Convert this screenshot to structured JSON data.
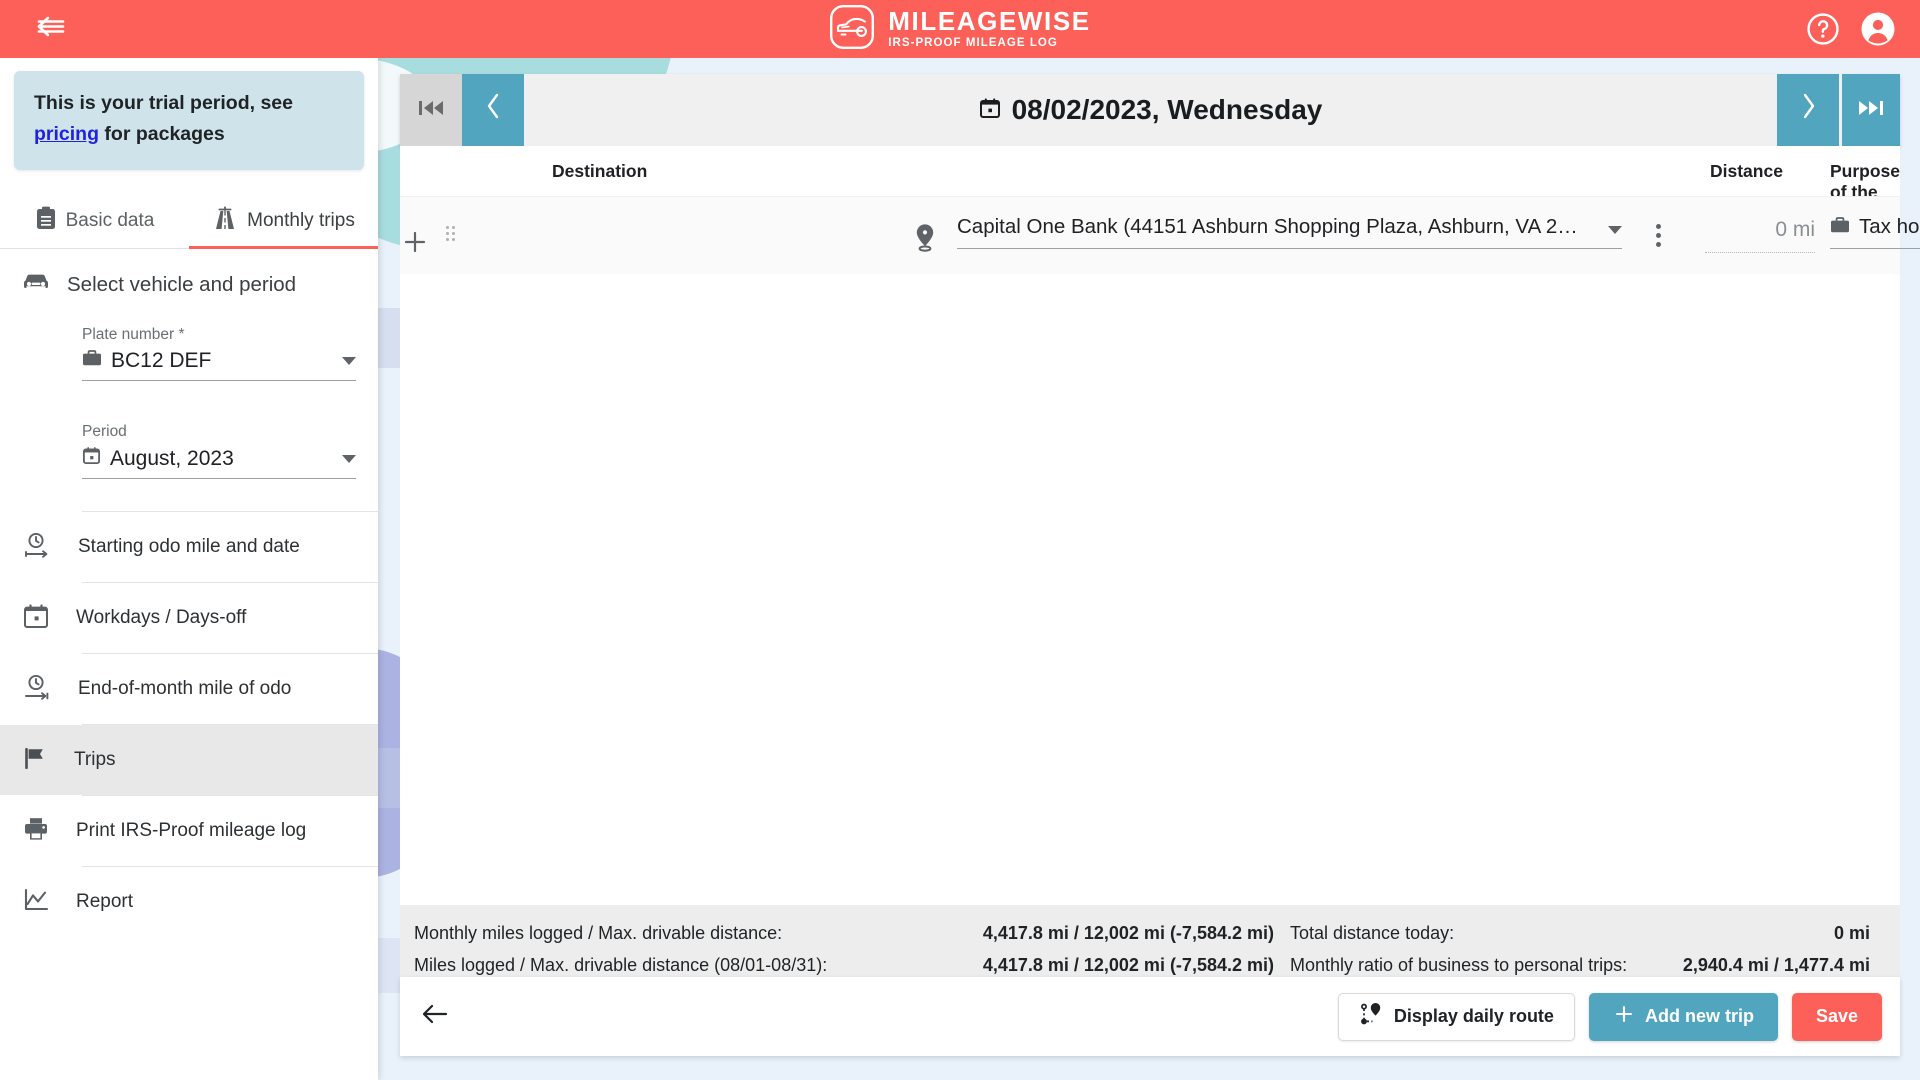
{
  "header": {
    "collapse_icon": "collapse-sidebar-icon",
    "logo_title": "MILEAGEWISE",
    "logo_subtitle": "IRS-PROOF MILEAGE LOG",
    "logo_icon": "car-logo-icon",
    "help_icon": "help-circle-icon",
    "account_icon": "account-circle-icon",
    "brand_color": "#fc6058"
  },
  "sidebar": {
    "trial_banner": {
      "text_before": "This is your trial period, see ",
      "link": "pricing",
      "text_after": " for packages",
      "line1": "This is your trial period, see",
      "bg_color": "#cfe3ea"
    },
    "tabs": [
      {
        "label": "Basic data",
        "icon": "clipboard-icon",
        "active": false
      },
      {
        "label": "Monthly trips",
        "icon": "highway-road-icon",
        "active": true
      }
    ],
    "section": {
      "label": "Select vehicle and period",
      "icon": "car-icon"
    },
    "fields": [
      {
        "label": "Plate number *",
        "value": "BC12 DEF",
        "icon": "briefcase-icon"
      },
      {
        "label": "Period",
        "value": "August, 2023",
        "icon": "calendar-icon"
      }
    ],
    "menu": [
      {
        "label": "Starting odo mile and date",
        "icon": "clock-start-icon",
        "selected": false
      },
      {
        "label": "Workdays / Days-off",
        "icon": "calendar-icon",
        "selected": false
      },
      {
        "label": "End-of-month mile of odo",
        "icon": "clock-end-icon",
        "selected": false
      },
      {
        "label": "Trips",
        "icon": "flag-icon",
        "selected": true
      },
      {
        "label": "Print IRS-Proof mileage log",
        "icon": "printer-icon",
        "selected": false
      },
      {
        "label": "Report",
        "icon": "chart-line-icon",
        "selected": false
      }
    ]
  },
  "main": {
    "date_nav": {
      "first_icon": "skip-to-first-icon",
      "prev_icon": "chevron-left-icon",
      "date_icon": "calendar-icon",
      "date_text": "08/02/2023, Wednesday",
      "next_icon": "chevron-right-icon",
      "last_icon": "skip-to-last-icon",
      "accent_color": "#51a5bf"
    },
    "table": {
      "columns": {
        "destination": "Destination",
        "distance": "Distance",
        "purpose": "Purpose of the trip"
      },
      "rows": [
        {
          "drag_handle": "drag-handle-icon",
          "add_icon": "plus-icon",
          "pin_icon": "map-pin-icon",
          "destination": "Capital One Bank (44151 Ashburn Shopping Plaza, Ashburn, VA 2…",
          "distance": "0 mi",
          "purpose": "Tax home",
          "purpose_icon": "briefcase-icon",
          "count_icon": "numbers-icon",
          "delete_icon": "trash-icon"
        }
      ]
    },
    "stats": [
      {
        "label": "Monthly miles logged / Max. drivable distance:",
        "value": "4,417.8 mi / 12,002 mi (-7,584.2 mi)",
        "right_label": "Total distance today:",
        "right_value": "0 mi"
      },
      {
        "label": "Miles logged / Max. drivable distance (08/01-08/31):",
        "value": "4,417.8 mi / 12,002 mi (-7,584.2 mi)",
        "right_label": "Monthly ratio of business to personal trips:",
        "right_value": "2,940.4 mi / 1,477.4 mi"
      }
    ],
    "actions": {
      "back_icon": "arrow-left-icon",
      "daily_route_label": "Display daily route",
      "daily_route_icon": "route-pins-icon",
      "add_trip_label": "Add new trip",
      "add_trip_icon": "plus-icon",
      "save_label": "Save"
    }
  }
}
